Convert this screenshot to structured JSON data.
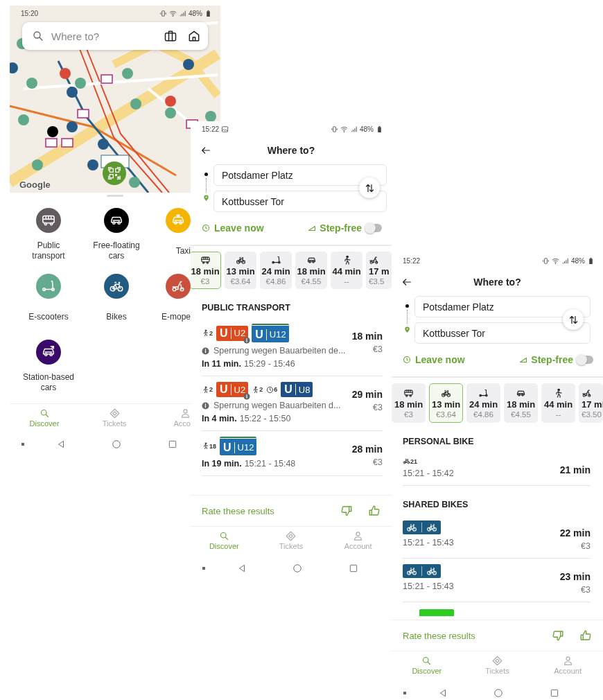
{
  "map_screen": {
    "status_bar": {
      "time": "15:20",
      "battery": "48%"
    },
    "search": {
      "placeholder": "Where to?"
    },
    "map_attribution": "Google",
    "categories": [
      {
        "kind": "bus",
        "label": "Public transport",
        "color": "#625c60"
      },
      {
        "kind": "car",
        "label": "Free-floating cars",
        "color": "#000000"
      },
      {
        "kind": "taxi",
        "label": "Taxi",
        "color": "#f5b400"
      },
      {
        "kind": "scooter",
        "label": "E-scooters",
        "color": "#64aa8e"
      },
      {
        "kind": "bike",
        "label": "Bikes",
        "color": "#235a82"
      },
      {
        "kind": "moped",
        "label": "E-mope",
        "color": "#c8503c"
      },
      {
        "kind": "station_car",
        "label": "Station-based cars",
        "color": "#3a0a6a"
      }
    ],
    "nav": [
      {
        "kind": "discover",
        "label": "Discover",
        "selected": true
      },
      {
        "kind": "tickets",
        "label": "Tickets",
        "selected": false
      },
      {
        "kind": "account",
        "label": "Acco",
        "selected": false
      }
    ]
  },
  "result_screens": [
    {
      "status_bar": {
        "time": "15:22",
        "notification": true,
        "battery": "48%"
      },
      "title": "Where to?",
      "from": "Potsdamer Platz",
      "to": "Kottbusser Tor",
      "leave": "Leave now",
      "step_free": {
        "label": "Step-free",
        "on": false
      },
      "modes": [
        {
          "kind": "bus",
          "time": "18 min",
          "price": "€3",
          "selected": true
        },
        {
          "kind": "bike",
          "time": "13 min",
          "price": "€3.64",
          "selected": false
        },
        {
          "kind": "scooter",
          "time": "24 min",
          "price": "€4.86",
          "selected": false
        },
        {
          "kind": "car",
          "time": "18 min",
          "price": "€4.55",
          "selected": false
        },
        {
          "kind": "walk",
          "time": "44 min",
          "price": "--",
          "selected": false
        },
        {
          "kind": "moped",
          "time": "17 m",
          "price": "€3.5",
          "selected": false
        }
      ],
      "sections": [
        {
          "title": "PUBLIC TRANSPORT",
          "routes": [
            {
              "legs": [
                {
                  "kind": "walk",
                  "value": "2"
                },
                {
                  "kind": "line",
                  "prefix": "U",
                  "line": "U2",
                  "color": "#dc4a1d",
                  "info": true,
                  "stripe": false
                },
                {
                  "kind": "line",
                  "prefix": "U",
                  "line": "U12",
                  "color": "#1f6fb0",
                  "info": false,
                  "stripe": true
                }
              ],
              "notice": "Sperrung wegen Bauarbeiten de...",
              "departure": "In 11 min.",
              "times": "15:29 - 15:46",
              "duration": "18 min",
              "price": "€3"
            },
            {
              "legs": [
                {
                  "kind": "walk",
                  "value": "2"
                },
                {
                  "kind": "line",
                  "prefix": "U",
                  "line": "U2",
                  "color": "#dc4a1d",
                  "info": true,
                  "stripe": false
                },
                {
                  "kind": "walk",
                  "value": "2"
                },
                {
                  "kind": "wait",
                  "value": "6"
                },
                {
                  "kind": "line",
                  "prefix": "U",
                  "line": "U8",
                  "color": "#1f4f8a",
                  "info": false,
                  "stripe": false
                }
              ],
              "notice": "Sperrung wegen Bauarbeiten d...",
              "departure": "In 4 min.",
              "times": "15:22 - 15:50",
              "duration": "29 min",
              "price": "€3"
            },
            {
              "legs": [
                {
                  "kind": "walk",
                  "value": "18"
                },
                {
                  "kind": "line",
                  "prefix": "U",
                  "line": "U12",
                  "color": "#1f6fb0",
                  "info": false,
                  "stripe": true
                }
              ],
              "departure": "In 19 min.",
              "times": "15:21 - 15:48",
              "duration": "28 min",
              "price": "€3"
            }
          ]
        }
      ],
      "rate": "Rate these results",
      "nav": [
        {
          "kind": "discover",
          "label": "Discover",
          "selected": true
        },
        {
          "kind": "tickets",
          "label": "Tickets",
          "selected": false
        },
        {
          "kind": "account",
          "label": "Account",
          "selected": false
        }
      ]
    },
    {
      "status_bar": {
        "time": "15:22",
        "notification": false,
        "battery": "48%"
      },
      "title": "Where to?",
      "from": "Potsdamer Platz",
      "to": "Kottbusser Tor",
      "leave": "Leave now",
      "step_free": {
        "label": "Step-free",
        "on": false
      },
      "modes": [
        {
          "kind": "bus",
          "time": "18 min",
          "price": "€3",
          "selected": false
        },
        {
          "kind": "bike",
          "time": "13 min",
          "price": "€3.64",
          "selected": true
        },
        {
          "kind": "scooter",
          "time": "24 min",
          "price": "€4.86",
          "selected": false
        },
        {
          "kind": "car",
          "time": "18 min",
          "price": "€4.55",
          "selected": false
        },
        {
          "kind": "walk",
          "time": "44 min",
          "price": "--",
          "selected": false
        },
        {
          "kind": "moped",
          "time": "17 mi",
          "price": "€3.50",
          "selected": false
        }
      ],
      "sections": [
        {
          "title": "PERSONAL BIKE",
          "routes": [
            {
              "legs": [
                {
                  "kind": "bike",
                  "value": "21"
                }
              ],
              "times": "15:21 - 15:42",
              "duration": "21 min"
            }
          ]
        },
        {
          "title": "SHARED BIKES",
          "routes": [
            {
              "legs": [
                {
                  "kind": "bikeshare",
                  "color": "#1d5a82"
                }
              ],
              "times": "15:21 - 15:43",
              "duration": "22 min",
              "price": "€3"
            },
            {
              "legs": [
                {
                  "kind": "bikeshare",
                  "color": "#1d5a82"
                }
              ],
              "times": "15:21 - 15:43",
              "duration": "23 min",
              "price": "€3"
            },
            {
              "legs": [
                {
                  "kind": "bikeshare",
                  "color": "#2ecc1f"
                }
              ]
            }
          ]
        }
      ],
      "rate": "Rate these results",
      "nav": [
        {
          "kind": "discover",
          "label": "Discover",
          "selected": true
        },
        {
          "kind": "tickets",
          "label": "Tickets",
          "selected": false
        },
        {
          "kind": "account",
          "label": "Account",
          "selected": false
        }
      ]
    }
  ]
}
